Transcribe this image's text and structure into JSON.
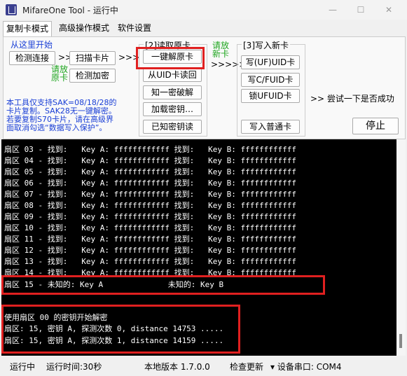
{
  "window": {
    "title": "MifareOne Tool - 运行中"
  },
  "tabs": [
    "复制卡模式",
    "高级操作模式",
    "软件设置"
  ],
  "panel": {
    "start_label": "从这里开始",
    "detect_btn": "检测连接",
    "arrow1": ">>",
    "scan_btn": "扫描卡片",
    "arrow2": ">>>",
    "insert_card_1": "请放",
    "insert_card_2": "原卡",
    "check_enc_btn": "检测加密",
    "step2_label": "[2]读取原卡",
    "one_click_btn": "一键解原卡",
    "uid_read_btn": "从UID卡读回",
    "crack_btn": "知一密破解",
    "load_key_btn": "加载密钥…",
    "known_key_btn": "已知密钥读",
    "new_card_1": "请放",
    "new_card_2": "新卡",
    "arrow3": ">>>>>",
    "step3_label": "[3]写入新卡",
    "write_uid_btn": "写(UF)UID卡",
    "write_cfuid_btn": "写C/FUID卡",
    "lock_ufuid_btn": "锁UFUID卡",
    "write_normal_btn": "写入普通卡",
    "try_label": ">> 尝试一下是否成功",
    "stop_btn": "停止",
    "note_1": "本工具仅支持SAK=08/18/28的",
    "note_2": "卡片复制。SAK28无一键解密。",
    "note_3": "若要复制S70卡片，请在高级界",
    "note_4": "面取消勾选“数据写入保护”。"
  },
  "console": {
    "lines": [
      "扇区 03 - 找到:   Key A: ffffffffffff 找到:   Key B: ffffffffffff",
      "扇区 04 - 找到:   Key A: ffffffffffff 找到:   Key B: ffffffffffff",
      "扇区 05 - 找到:   Key A: ffffffffffff 找到:   Key B: ffffffffffff",
      "扇区 06 - 找到:   Key A: ffffffffffff 找到:   Key B: ffffffffffff",
      "扇区 07 - 找到:   Key A: ffffffffffff 找到:   Key B: ffffffffffff",
      "扇区 08 - 找到:   Key A: ffffffffffff 找到:   Key B: ffffffffffff",
      "扇区 09 - 找到:   Key A: ffffffffffff 找到:   Key B: ffffffffffff",
      "扇区 10 - 找到:   Key A: ffffffffffff 找到:   Key B: ffffffffffff",
      "扇区 11 - 找到:   Key A: ffffffffffff 找到:   Key B: ffffffffffff",
      "扇区 12 - 找到:   Key A: ffffffffffff 找到:   Key B: ffffffffffff",
      "扇区 13 - 找到:   Key A: ffffffffffff 找到:   Key B: ffffffffffff",
      "扇区 14 - 找到:   Key A: ffffffffffff 找到:   Key B: ffffffffffff",
      "扇区 15 - 未知的: Key A              未知的: Key B",
      "",
      "使用扇区 00 的密钥开始解密",
      "扇区: 15, 密钥 A, 探测次数 0, distance 14753 .....",
      "扇区: 15, 密钥 A, 探测次数 1, distance 14159 ....."
    ]
  },
  "status": {
    "state": "运行中",
    "runtime": "运行时间:30秒",
    "version": "本地版本 1.7.0.0",
    "check_update": "检查更新",
    "device_port": "▾ 设备串口: COM4"
  },
  "colors": {
    "highlight": "#e02020",
    "console_bg": "#000000",
    "blue_text": "#1a3fd6",
    "green_text": "#1ea51e"
  }
}
